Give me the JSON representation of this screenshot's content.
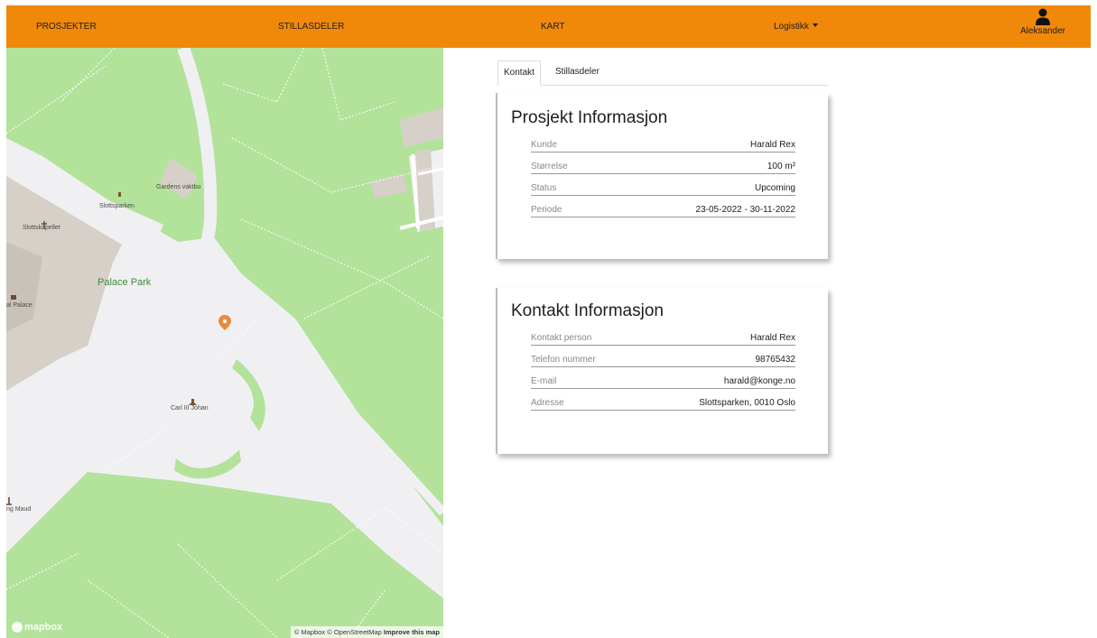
{
  "nav": {
    "projects": "PROSJEKTER",
    "parts": "STILLASDELER",
    "map": "KART",
    "logistics": "Logistikk",
    "user": "Aleksander"
  },
  "map": {
    "labels": {
      "gardens": "Gardens vaktbu",
      "slottsparken": "Slottsparken",
      "chapel": "Slottskapellet",
      "palace_park": "Palace Park",
      "palace": "al Palace",
      "statue": "Carl III Johan",
      "maud": "ng Maud"
    },
    "attribution_prefix": "© Mapbox © OpenStreetMap",
    "attribution_link": "Improve this map",
    "logo": "mapbox",
    "pin_color": "#e98b3a"
  },
  "tabs": [
    {
      "label": "Kontakt",
      "active": true
    },
    {
      "label": "Stillasdeler",
      "active": false
    }
  ],
  "project_card": {
    "title": "Prosjekt Informasjon",
    "rows": [
      {
        "label": "Kunde",
        "value": "Harald Rex"
      },
      {
        "label": "Størrelse",
        "value": "100 m²"
      },
      {
        "label": "Status",
        "value": "Upcoming"
      },
      {
        "label": "Periode",
        "value": "23-05-2022 - 30-11-2022"
      }
    ]
  },
  "contact_card": {
    "title": "Kontakt Informasjon",
    "rows": [
      {
        "label": "Kontakt person",
        "value": "Harald Rex"
      },
      {
        "label": "Telefon nummer",
        "value": "98765432"
      },
      {
        "label": "E-mail",
        "value": "harald@konge.no"
      },
      {
        "label": "Adresse",
        "value": "Slottsparken, 0010 Oslo"
      }
    ]
  },
  "colors": {
    "nav_bg": "#f0890a",
    "park_green": "#b3e29b",
    "plaza": "#f0f0f3"
  }
}
